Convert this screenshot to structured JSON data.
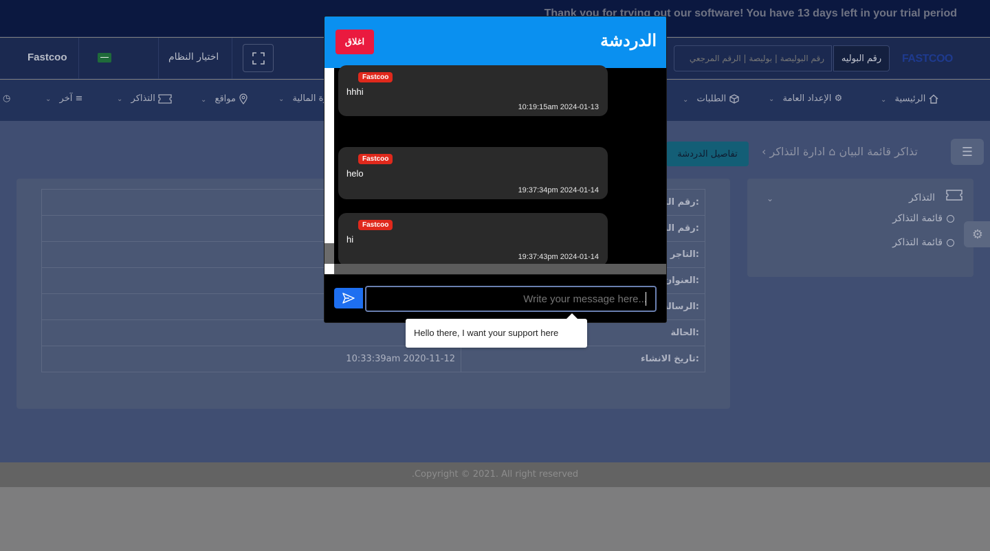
{
  "trial_banner": {
    "text": "Thank you for trying out our software! You have 13 days left in your trial period"
  },
  "topbar": {
    "user_name": "Fastcoo",
    "flag_icon": "saudi-flag-icon",
    "system_select_label": "اختيار النظام",
    "fullscreen_icon": "fullscreen-icon",
    "search_placeholder": "رقم البوليصة | بوليصة | الرقم المرجعي",
    "search_button_label": "رقم البوليه",
    "logo_text": "FASTCOO"
  },
  "nav": {
    "items": [
      {
        "label": "الرئيسية",
        "icon": "home-icon"
      },
      {
        "label": "الإعداد العامة",
        "icon": "gear-icon"
      },
      {
        "label": "الطلبات",
        "icon": "box-icon"
      },
      {
        "label": "رة المالية",
        "icon": ""
      },
      {
        "label": "مواقع",
        "icon": "map-pin-icon"
      },
      {
        "label": "التذاكر",
        "icon": "ticket-icon"
      },
      {
        "label": "آخر",
        "icon": "filter-icon"
      }
    ]
  },
  "breadcrumb": {
    "root": "ادارة التذاكر",
    "current": "تذاكر قائمة البيان"
  },
  "chat_details_button": "تفاصيل الدردشة",
  "sidebar": {
    "title": "التذاكر",
    "items": [
      {
        "label": "قائمة التذاكر"
      },
      {
        "label": "قائمة التذاكر"
      }
    ]
  },
  "details": {
    "rows": [
      {
        "label": "رقم التذكرة:",
        "value": ""
      },
      {
        "label": "رقم البيان:",
        "value": ""
      },
      {
        "label": "التاجر:",
        "value": ""
      },
      {
        "label": "العنوان:",
        "value": ""
      },
      {
        "label": "الرسالة:",
        "value": ""
      },
      {
        "label": "الحالة:",
        "value": ""
      },
      {
        "label": "تاريخ الانشاء:",
        "value": "10:33:39am 2020-11-12"
      }
    ]
  },
  "footer": {
    "text": ".Copyright © 2021. All right reserved"
  },
  "chat": {
    "title": "الدردشة",
    "close_label": "اغلاق",
    "messages": [
      {
        "sender": "Fastcoo",
        "text": "hhhi",
        "time": "10:19:15am 2024-01-13"
      },
      {
        "sender": "Fastcoo",
        "text": "helo",
        "time": "19:37:34pm 2024-01-14"
      },
      {
        "sender": "Fastcoo",
        "text": "hi",
        "time": "19:37:43pm 2024-01-14"
      }
    ],
    "input_placeholder": "Write your message here...",
    "send_icon": "send-icon"
  },
  "tooltip": {
    "text": "Hello  there, I want your support here"
  }
}
